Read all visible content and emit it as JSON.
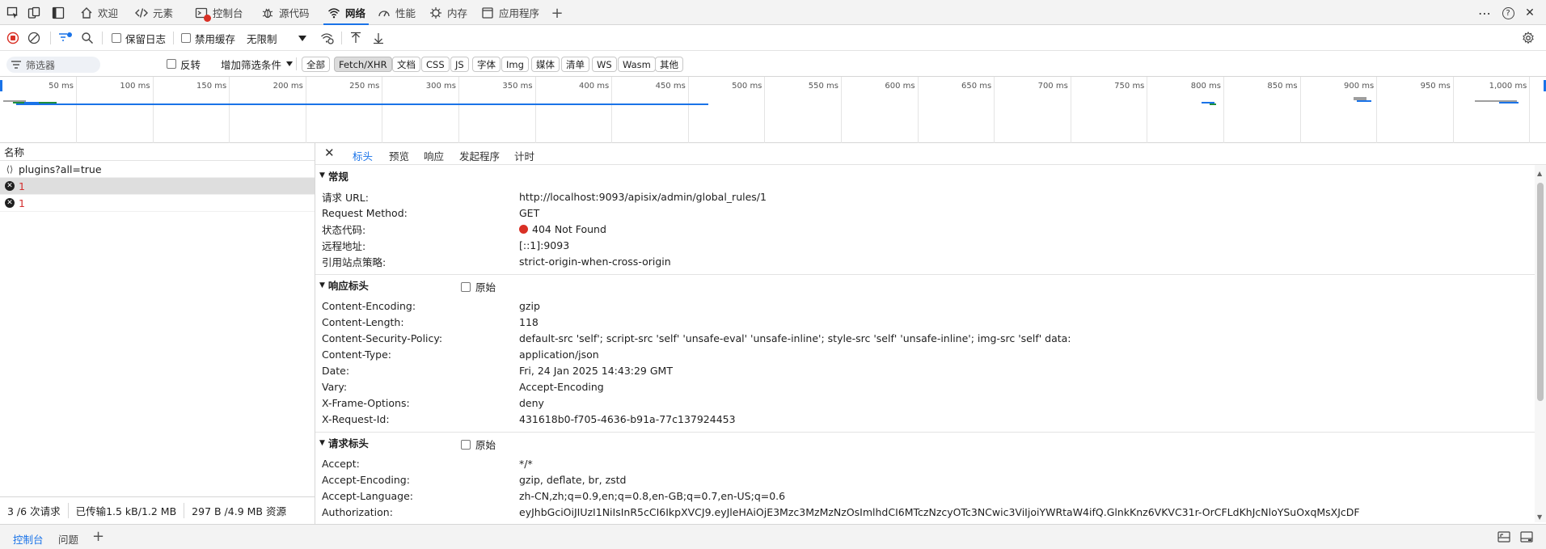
{
  "tabbar": {
    "tabs": [
      {
        "label": "欢迎",
        "icon": "home-icon"
      },
      {
        "label": "元素",
        "icon": "code-icon"
      },
      {
        "label": "控制台",
        "icon": "console-icon"
      },
      {
        "label": "源代码",
        "icon": "bug-icon"
      },
      {
        "label": "网络",
        "icon": "wifi-icon",
        "active": true
      },
      {
        "label": "性能",
        "icon": "gauge-icon"
      },
      {
        "label": "内存",
        "icon": "memory-icon"
      },
      {
        "label": "应用程序",
        "icon": "app-icon"
      }
    ],
    "add_tab": "+",
    "more": "⋯",
    "help": "?",
    "close": "✕"
  },
  "toolbar": {
    "preserve_log": "保留日志",
    "disable_cache": "禁用缓存",
    "throttling": "无限制"
  },
  "filterbar": {
    "filter_placeholder": "筛选器",
    "invert": "反转",
    "more_filters": "增加筛选条件",
    "types": [
      "全部",
      "Fetch/XHR",
      "文档",
      "CSS",
      "JS",
      "字体",
      "Img",
      "媒体",
      "清单",
      "WS",
      "Wasm",
      "其他"
    ],
    "selected_type": "Fetch/XHR"
  },
  "overview": {
    "ticks": [
      "50 ms",
      "100 ms",
      "150 ms",
      "200 ms",
      "250 ms",
      "300 ms",
      "350 ms",
      "400 ms",
      "450 ms",
      "500 ms",
      "550 ms",
      "600 ms",
      "650 ms",
      "700 ms",
      "750 ms",
      "800 ms",
      "850 ms",
      "900 ms",
      "950 ms",
      "1,000 ms"
    ]
  },
  "requests": {
    "header": "名称",
    "items": [
      {
        "name": "plugins?all=true",
        "status": "ok"
      },
      {
        "name": "1",
        "status": "error",
        "selected": true
      },
      {
        "name": "1",
        "status": "error"
      }
    ]
  },
  "statusbar": {
    "requests": "3 /6 次请求",
    "transferred": "已传输1.5 kB/1.2 MB",
    "resources": "297 B /4.9 MB 资源"
  },
  "detail": {
    "tabs": [
      "标头",
      "预览",
      "响应",
      "发起程序",
      "计时"
    ],
    "general": {
      "title": "常规",
      "rows": [
        {
          "k": "请求 URL:",
          "v": "http://localhost:9093/apisix/admin/global_rules/1"
        },
        {
          "k": "Request Method:",
          "v": "GET"
        },
        {
          "k": "状态代码:",
          "v": "404 Not Found"
        },
        {
          "k": "远程地址:",
          "v": "[::1]:9093"
        },
        {
          "k": "引用站点策略:",
          "v": "strict-origin-when-cross-origin"
        }
      ]
    },
    "response_headers": {
      "title": "响应标头",
      "raw": "原始",
      "rows": [
        {
          "k": "Content-Encoding:",
          "v": "gzip"
        },
        {
          "k": "Content-Length:",
          "v": "118"
        },
        {
          "k": "Content-Security-Policy:",
          "v": "default-src 'self'; script-src 'self' 'unsafe-eval' 'unsafe-inline'; style-src 'self' 'unsafe-inline'; img-src 'self' data:"
        },
        {
          "k": "Content-Type:",
          "v": "application/json"
        },
        {
          "k": "Date:",
          "v": "Fri, 24 Jan 2025 14:43:29 GMT"
        },
        {
          "k": "Vary:",
          "v": "Accept-Encoding"
        },
        {
          "k": "X-Frame-Options:",
          "v": "deny"
        },
        {
          "k": "X-Request-Id:",
          "v": "431618b0-f705-4636-b91a-77c137924453"
        }
      ]
    },
    "request_headers": {
      "title": "请求标头",
      "raw": "原始",
      "rows": [
        {
          "k": "Accept:",
          "v": "*/*"
        },
        {
          "k": "Accept-Encoding:",
          "v": "gzip, deflate, br, zstd"
        },
        {
          "k": "Accept-Language:",
          "v": "zh-CN,zh;q=0.9,en;q=0.8,en-GB;q=0.7,en-US;q=0.6"
        },
        {
          "k": "Authorization:",
          "v": "eyJhbGciOiJIUzI1NiIsInR5cCI6IkpXVCJ9.eyJleHAiOjE3Mzc3MzMzNzOsImlhdCI6MTczNzcyOTc3NCwic3ViIjoiYWRtaW4ifQ.GlnkKnz6VKVC31r-OrCFLdKhJcNloYSuOxqMsXJcDF"
        }
      ]
    }
  },
  "drawer": {
    "tabs": [
      "控制台",
      "问题"
    ],
    "add": "+"
  }
}
